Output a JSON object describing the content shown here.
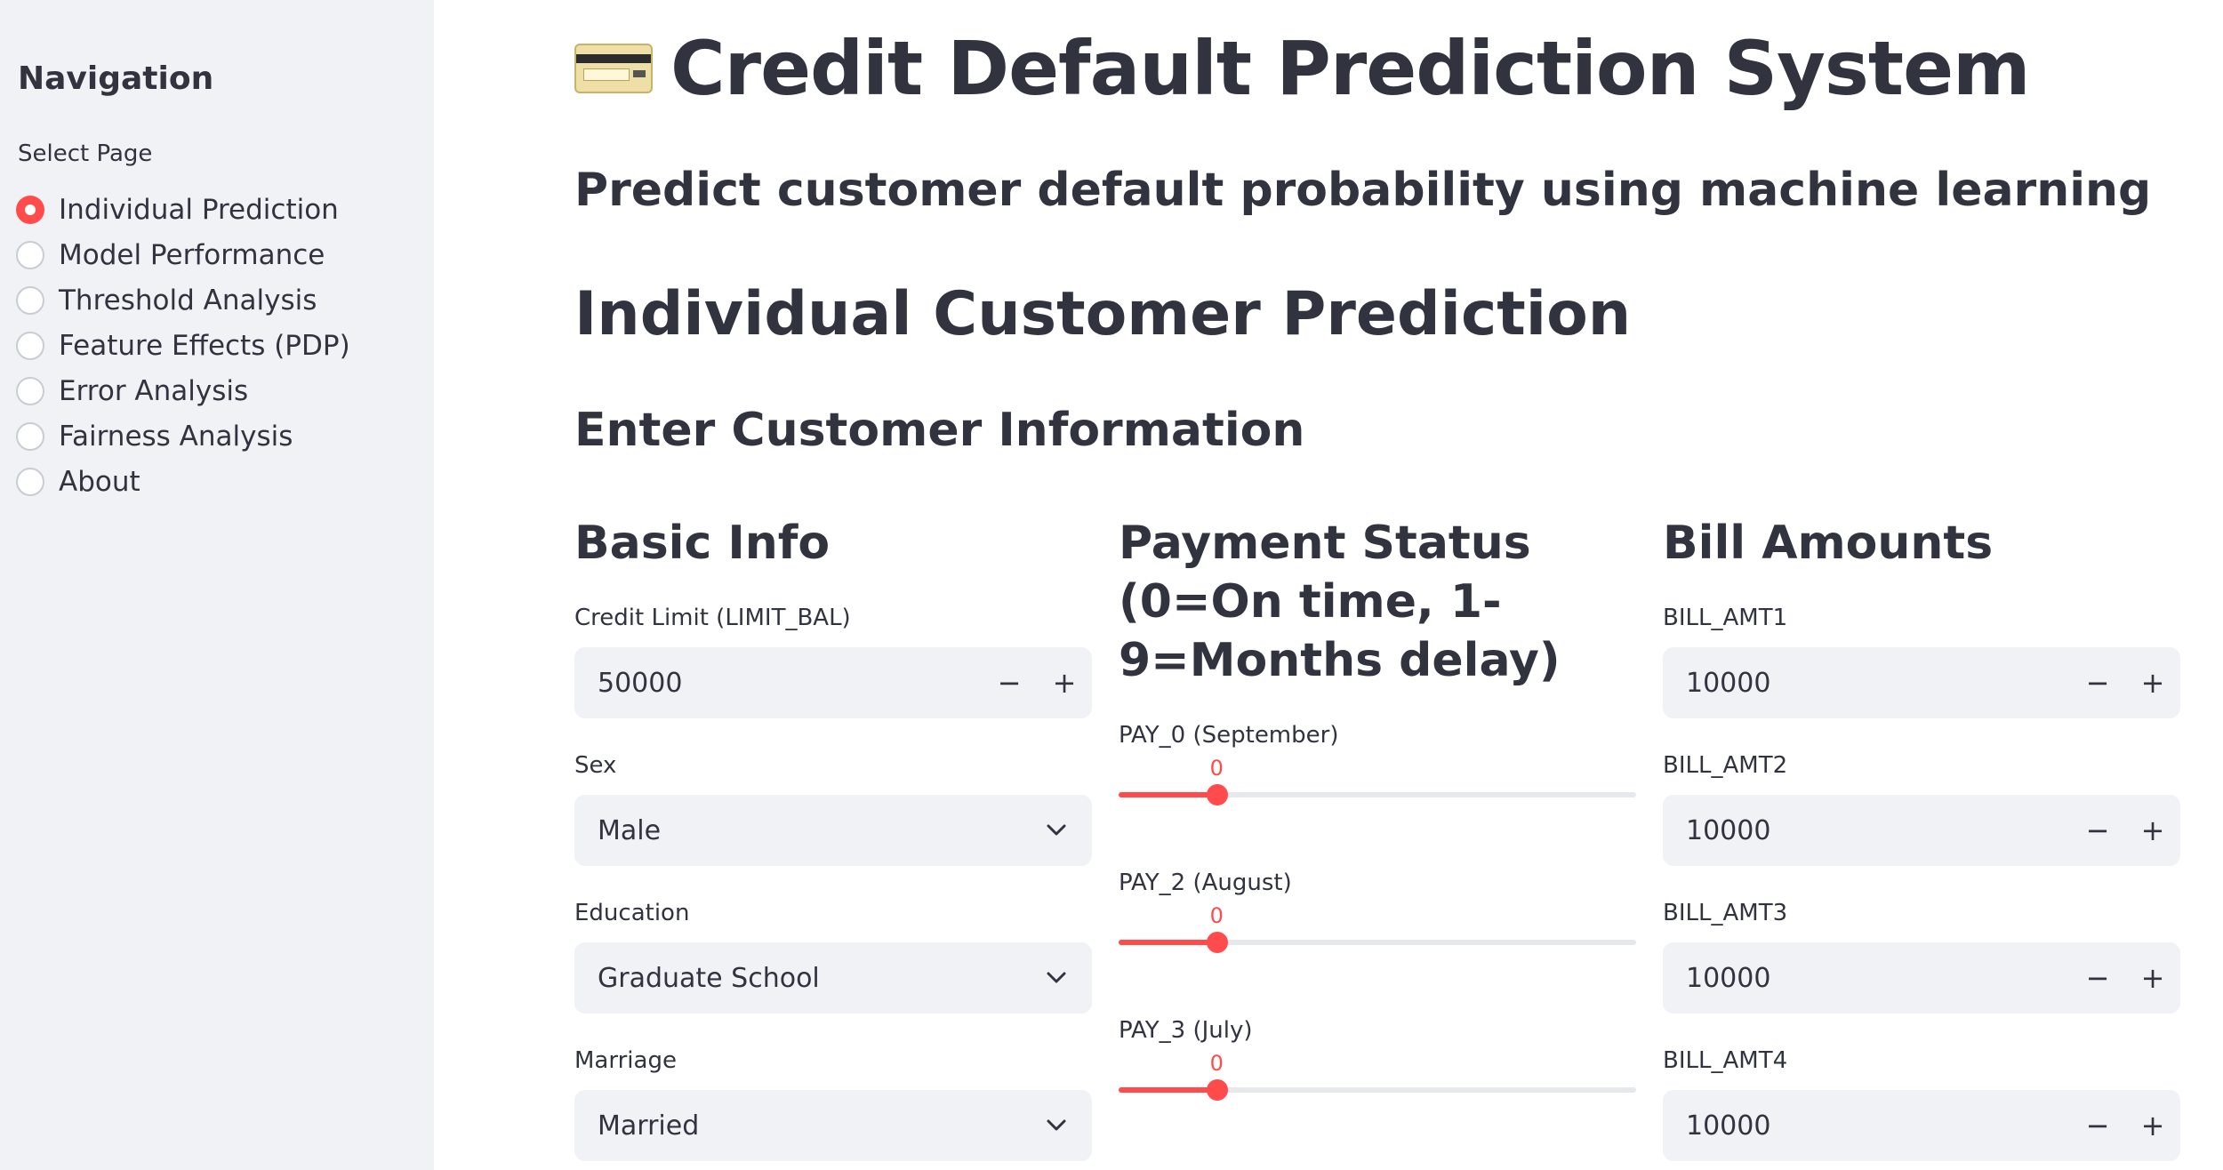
{
  "sidebar": {
    "title": "Navigation",
    "select_label": "Select Page",
    "items": [
      {
        "label": "Individual Prediction",
        "selected": true
      },
      {
        "label": "Model Performance",
        "selected": false
      },
      {
        "label": "Threshold Analysis",
        "selected": false
      },
      {
        "label": "Feature Effects (PDP)",
        "selected": false
      },
      {
        "label": "Error Analysis",
        "selected": false
      },
      {
        "label": "Fairness Analysis",
        "selected": false
      },
      {
        "label": "About",
        "selected": false
      }
    ]
  },
  "main": {
    "title": "Credit Default Prediction System",
    "title_icon": "credit-card-icon",
    "subtitle": "Predict customer default probability using machine learning",
    "section_title": "Individual Customer Prediction",
    "form_title": "Enter Customer Information",
    "basic_info": {
      "heading": "Basic Info",
      "credit_limit": {
        "label": "Credit Limit (LIMIT_BAL)",
        "value": "50000"
      },
      "sex": {
        "label": "Sex",
        "value": "Male"
      },
      "education": {
        "label": "Education",
        "value": "Graduate School"
      },
      "marriage": {
        "label": "Marriage",
        "value": "Married"
      }
    },
    "payment_status": {
      "heading": "Payment Status (0=On time, 1-9=Months delay)",
      "sliders": [
        {
          "label": "PAY_0 (September)",
          "value": "0",
          "fraction": 0.19
        },
        {
          "label": "PAY_2 (August)",
          "value": "0",
          "fraction": 0.19
        },
        {
          "label": "PAY_3 (July)",
          "value": "0",
          "fraction": 0.19
        }
      ]
    },
    "bill_amounts": {
      "heading": "Bill Amounts",
      "fields": [
        {
          "label": "BILL_AMT1",
          "value": "10000"
        },
        {
          "label": "BILL_AMT2",
          "value": "10000"
        },
        {
          "label": "BILL_AMT3",
          "value": "10000"
        },
        {
          "label": "BILL_AMT4",
          "value": "10000"
        }
      ]
    },
    "stepper": {
      "minus": "−",
      "plus": "+"
    }
  },
  "colors": {
    "accent": "#ff4b4b",
    "sidebar_bg": "#f0f2f6",
    "text": "#31333f",
    "input_bg": "#f0f2f6"
  }
}
